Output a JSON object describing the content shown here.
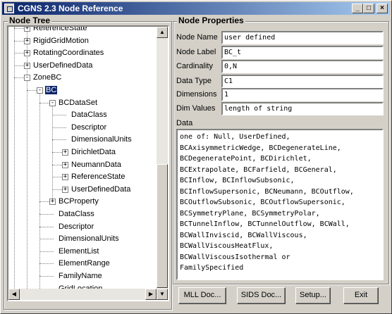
{
  "window": {
    "title": "CGNS 2.3 Node Reference"
  },
  "tree": {
    "label": "Node Tree",
    "nodes": [
      {
        "label": "ReferenceState",
        "level": 1,
        "expander": "+"
      },
      {
        "label": "RigidGridMotion",
        "level": 1,
        "expander": "+"
      },
      {
        "label": "RotatingCoordinates",
        "level": 1,
        "expander": "+"
      },
      {
        "label": "UserDefinedData",
        "level": 1,
        "expander": "+"
      },
      {
        "label": "ZoneBC",
        "level": 1,
        "expander": "-"
      },
      {
        "label": "BC",
        "level": 2,
        "expander": "-",
        "selected": true
      },
      {
        "label": "BCDataSet",
        "level": 3,
        "expander": "-"
      },
      {
        "label": "DataClass",
        "level": 4,
        "expander": ""
      },
      {
        "label": "Descriptor",
        "level": 4,
        "expander": ""
      },
      {
        "label": "DimensionalUnits",
        "level": 4,
        "expander": ""
      },
      {
        "label": "DirichletData",
        "level": 4,
        "expander": "+"
      },
      {
        "label": "NeumannData",
        "level": 4,
        "expander": "+"
      },
      {
        "label": "ReferenceState",
        "level": 4,
        "expander": "+"
      },
      {
        "label": "UserDefinedData",
        "level": 4,
        "expander": "+"
      },
      {
        "label": "BCProperty",
        "level": 3,
        "expander": "+"
      },
      {
        "label": "DataClass",
        "level": 3,
        "expander": ""
      },
      {
        "label": "Descriptor",
        "level": 3,
        "expander": ""
      },
      {
        "label": "DimensionalUnits",
        "level": 3,
        "expander": ""
      },
      {
        "label": "ElementList",
        "level": 3,
        "expander": ""
      },
      {
        "label": "ElementRange",
        "level": 3,
        "expander": ""
      },
      {
        "label": "FamilyName",
        "level": 3,
        "expander": ""
      },
      {
        "label": "GridLocation",
        "level": 3,
        "expander": ""
      },
      {
        "label": "",
        "level": 3,
        "expander": ""
      }
    ]
  },
  "props": {
    "label": "Node Properties",
    "fields": [
      {
        "label": "Node Name",
        "value": "user defined"
      },
      {
        "label": "Node Label",
        "value": "BC_t"
      },
      {
        "label": "Cardinality",
        "value": "0,N"
      },
      {
        "label": "Data Type",
        "value": "C1"
      },
      {
        "label": "Dimensions",
        "value": "1"
      },
      {
        "label": "Dim Values",
        "value": "length of string"
      }
    ],
    "data_label": "Data",
    "data_text": "one of: Null, UserDefined,\nBCAxisymmetricWedge, BCDegenerateLine,\nBCDegeneratePoint, BCDirichlet,\nBCExtrapolate, BCFarfield, BCGeneral,\nBCInflow, BCInflowSubsonic,\nBCInflowSupersonic, BCNeumann, BCOutflow,\nBCOutflowSubsonic, BCOutflowSupersonic,\nBCSymmetryPlane, BCSymmetryPolar,\nBCTunnelInflow, BCTunnelOutflow, BCWall,\nBCWallInviscid, BCWallViscous,\nBCWallViscousHeatFlux,\nBCWallViscousIsothermal or\nFamilySpecified"
  },
  "buttons": {
    "mll": "MLL Doc...",
    "sids": "SIDS Doc...",
    "setup": "Setup...",
    "exit": "Exit"
  }
}
